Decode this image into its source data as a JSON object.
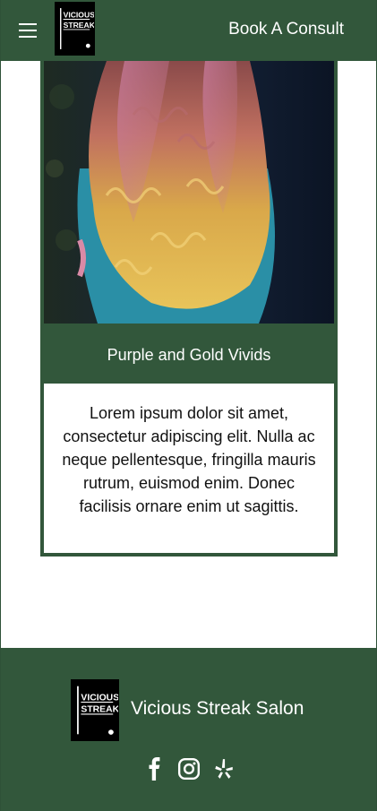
{
  "header": {
    "menu_icon": "hamburger-icon",
    "logo_text_line1": "VICIOUS",
    "logo_text_line2": "STREAK",
    "cta_label": "Book A Consult"
  },
  "card": {
    "photo_subject": "long curly hair with purple and gold vivid color",
    "title": "Purple and Gold Vivids",
    "body": "Lorem ipsum dolor sit amet, consectetur adipiscing elit. Nulla ac neque pellentesque, fringilla mauris rutrum, euismod enim. Donec facilisis ornare enim ut sagittis."
  },
  "footer": {
    "logo_text_line1": "VICIOUS",
    "logo_text_line2": "STREAK",
    "salon_name": "Vicious Streak Salon",
    "social": [
      {
        "icon": "facebook-icon"
      },
      {
        "icon": "instagram-icon"
      },
      {
        "icon": "yelp-icon"
      }
    ]
  },
  "colors": {
    "brand_green": "#32573b",
    "text_light": "#ffffff",
    "text_dark": "#111111"
  }
}
